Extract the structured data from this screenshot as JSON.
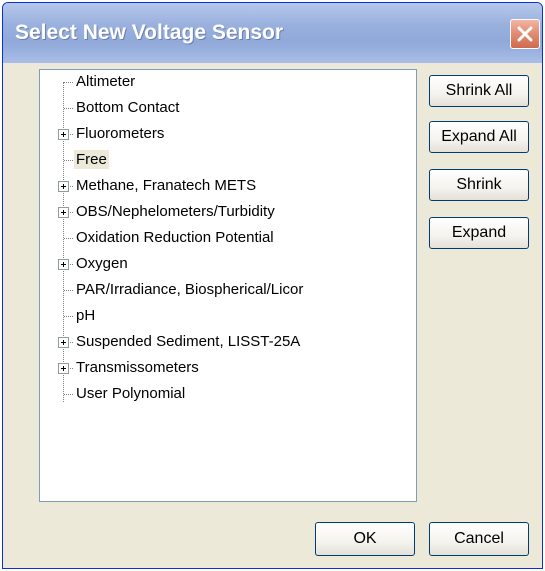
{
  "window": {
    "title": "Select New Voltage Sensor",
    "close_icon": "close-icon"
  },
  "tree": {
    "items": [
      {
        "label": "Altimeter",
        "expandable": false
      },
      {
        "label": "Bottom Contact",
        "expandable": false
      },
      {
        "label": "Fluorometers",
        "expandable": true
      },
      {
        "label": "Free",
        "expandable": false,
        "selected": true
      },
      {
        "label": "Methane, Franatech METS",
        "expandable": true
      },
      {
        "label": "OBS/Nephelometers/Turbidity",
        "expandable": true
      },
      {
        "label": "Oxidation Reduction Potential",
        "expandable": false
      },
      {
        "label": "Oxygen",
        "expandable": true
      },
      {
        "label": "PAR/Irradiance, Biospherical/Licor",
        "expandable": false
      },
      {
        "label": "pH",
        "expandable": false
      },
      {
        "label": "Suspended Sediment, LISST-25A",
        "expandable": true
      },
      {
        "label": "Transmissometers",
        "expandable": true
      },
      {
        "label": "User Polynomial",
        "expandable": false
      }
    ]
  },
  "buttons": {
    "shrink_all": "Shrink All",
    "expand_all": "Expand All",
    "shrink": "Shrink",
    "expand": "Expand",
    "ok": "OK",
    "cancel": "Cancel"
  }
}
